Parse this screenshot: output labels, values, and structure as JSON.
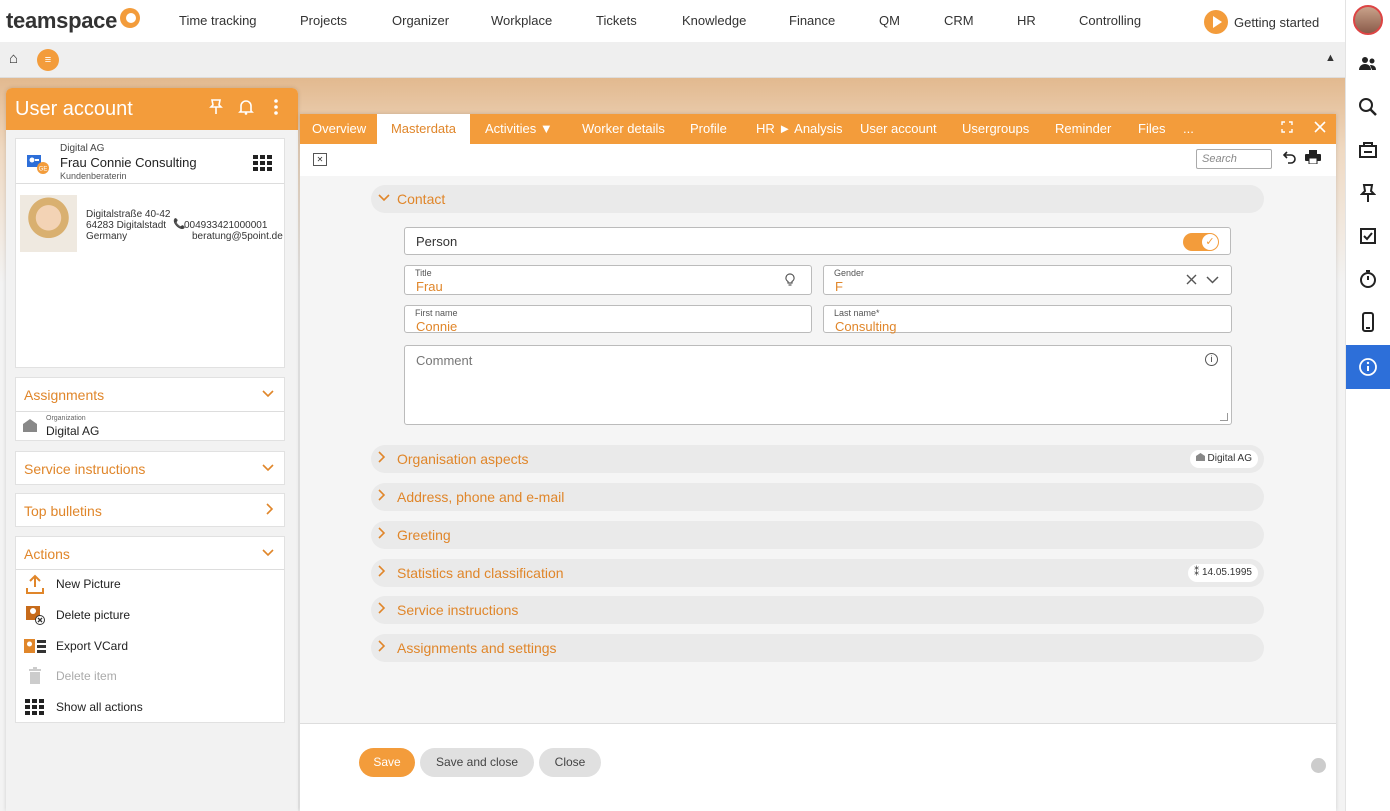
{
  "app": {
    "logo": "teamspace"
  },
  "nav": {
    "items": [
      "Time tracking",
      "Projects",
      "Organizer",
      "Workplace",
      "Tickets",
      "Knowledge",
      "Finance",
      "QM",
      "CRM",
      "HR",
      "Controlling"
    ],
    "getting_started": "Getting started"
  },
  "panel": {
    "title": "User account",
    "contact": {
      "company": "Digital AG",
      "name": "Frau Connie Consulting",
      "role": "Kundenberaterin",
      "street": "Digitalstraße 40-42",
      "city": "64283 Digitalstadt",
      "country": "Germany",
      "phone": "004933421000001",
      "email": "beratung@5point.de"
    },
    "assignments": {
      "title": "Assignments",
      "org_label": "Organization",
      "org_value": "Digital AG"
    },
    "service_instructions": "Service instructions",
    "top_bulletins": "Top bulletins",
    "actions": {
      "title": "Actions",
      "items": [
        "New Picture",
        "Delete picture",
        "Export VCard",
        "Delete item",
        "Show all actions"
      ]
    }
  },
  "window": {
    "tabs": [
      "Overview",
      "Masterdata",
      "Activities ▼",
      "Worker details",
      "Profile",
      "HR ► Analysis",
      "User account",
      "Usergroups",
      "Reminder",
      "Files",
      "..."
    ],
    "search_placeholder": "Search",
    "sections": {
      "contact": "Contact",
      "org_aspects": "Organisation aspects",
      "org_badge": "Digital AG",
      "address": "Address, phone and e-mail",
      "greeting": "Greeting",
      "statistics": "Statistics and classification",
      "stats_badge": "14.05.1995",
      "service": "Service instructions",
      "assign_settings": "Assignments and settings"
    },
    "form": {
      "person_label": "Person",
      "person_toggle": true,
      "title_label": "Title",
      "title_value": "Frau",
      "gender_label": "Gender",
      "gender_value": "F",
      "first_label": "First name",
      "first_value": "Connie",
      "last_label": "Last name*",
      "last_value": "Consulting",
      "comment_label": "Comment"
    },
    "buttons": {
      "save": "Save",
      "save_close": "Save and close",
      "close": "Close"
    }
  },
  "colors": {
    "accent": "#f39c3b",
    "accent_text": "#e0862a",
    "active_rail": "#2d6fd9"
  }
}
